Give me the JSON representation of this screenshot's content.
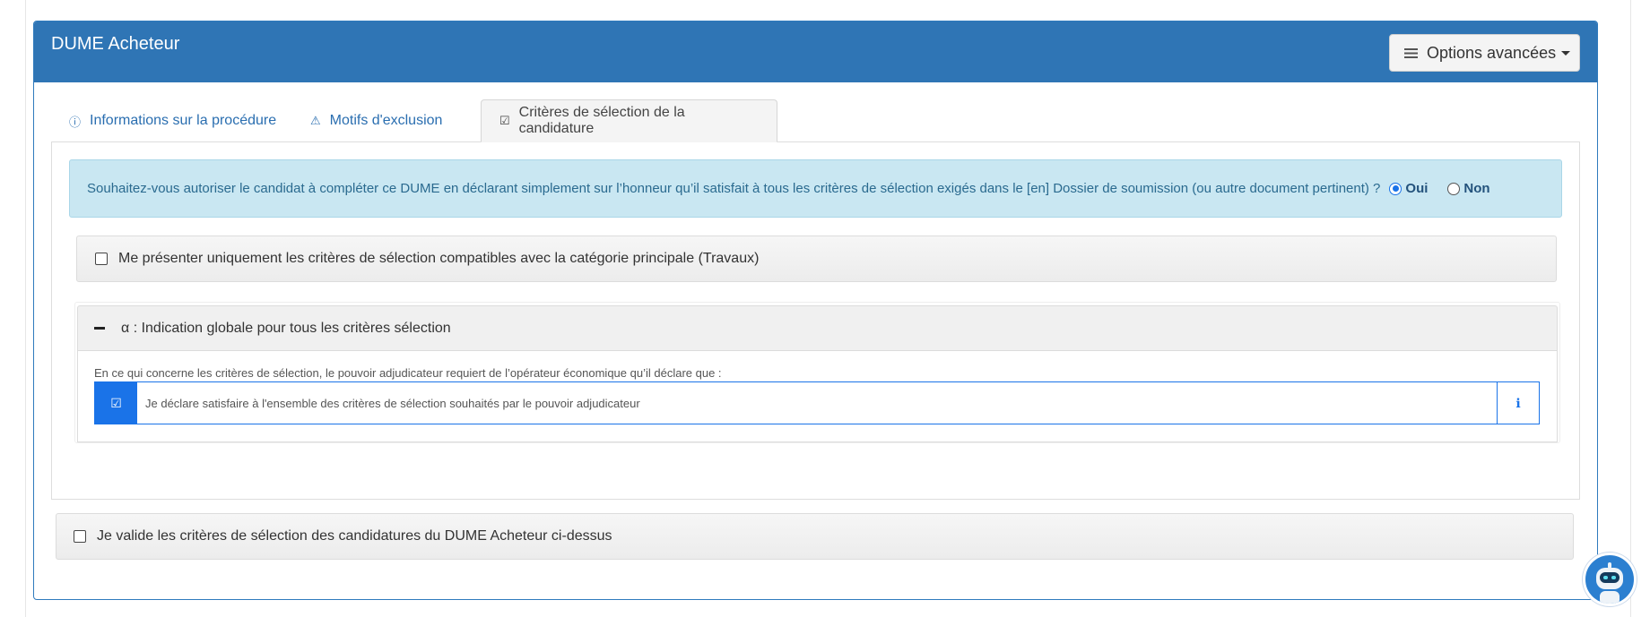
{
  "panel": {
    "title": "DUME Acheteur",
    "options_button": "Options avancées"
  },
  "tabs": [
    {
      "icon": "info-icon",
      "glyph": "ⓘ",
      "label": "Informations sur la procédure",
      "active": false
    },
    {
      "icon": "warning-icon",
      "glyph": "⚠",
      "label": "Motifs d'exclusion",
      "active": false
    },
    {
      "icon": "checkbox-icon",
      "glyph": "☑",
      "label": "Critères de sélection de la candidature",
      "active": true
    }
  ],
  "alert": {
    "question": "Souhaitez-vous autoriser le candidat à compléter ce DUME en déclarant simplement sur l’honneur qu’il satisfait à tous les critères de sélection exigés dans le [en] Dossier de soumission (ou autre document pertinent) ?",
    "options": [
      {
        "label": "Oui",
        "checked": true
      },
      {
        "label": "Non",
        "checked": false
      }
    ]
  },
  "filter": {
    "label": "Me présenter uniquement les critères de sélection compatibles avec la catégorie principale (Travaux)",
    "checked": false
  },
  "criterion": {
    "title": "α : Indication globale pour tous les critères sélection",
    "description": "En ce qui concerne les critères de sélection, le pouvoir adjudicateur requiert de l’opérateur économique qu’il déclare que :",
    "statement": "Je déclare satisfaire à l'ensemble des critères de sélection souhaités par le pouvoir adjudicateur",
    "check_glyph": "☑",
    "info_glyph": "ℹ"
  },
  "validate": {
    "label": "Je valide les critères de sélection des candidatures du DUME Acheteur ci-dessus",
    "checked": false
  },
  "colors": {
    "header": "#2f75b5",
    "alert_bg": "#c9e7f2",
    "accent": "#1a73e8",
    "tab_link": "#2a6eb0"
  }
}
